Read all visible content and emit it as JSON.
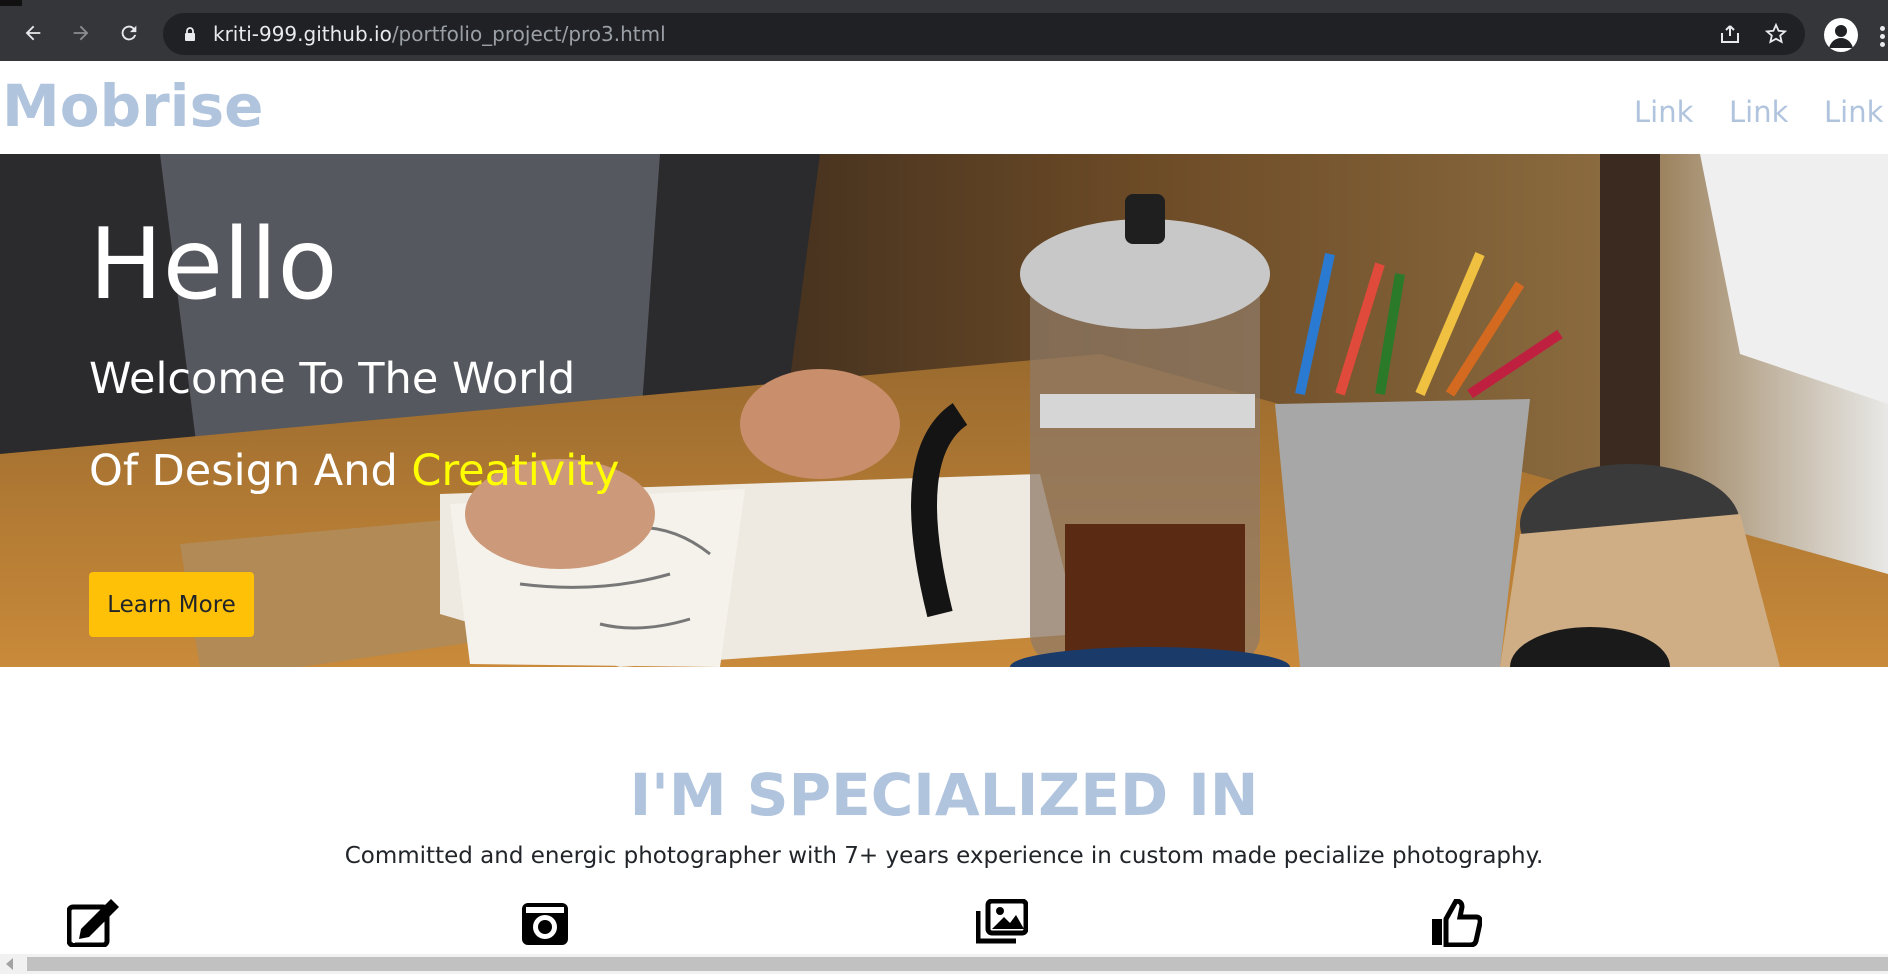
{
  "browser": {
    "url_host": "kriti-999.github.io",
    "url_path": "/portfolio_project/pro3.html"
  },
  "navbar": {
    "brand": "Mobrise",
    "links": [
      "Link",
      "Link",
      "Link"
    ],
    "brand_color": "#b0c4de"
  },
  "hero": {
    "title": "Hello",
    "line1": "Welcome To The World",
    "line2_prefix": "Of Design And ",
    "line2_highlight": "Creativity",
    "highlight_color": "#ffff00",
    "button_label": "Learn More",
    "button_color": "#ffc107"
  },
  "specialized": {
    "title": "I'M SPECIALIZED IN",
    "subtitle": "Committed and energic photographer with 7+ years experience in custom made pecialize photography.",
    "icons": [
      "edit-icon",
      "camera-icon",
      "images-icon",
      "thumbs-up-icon"
    ]
  }
}
